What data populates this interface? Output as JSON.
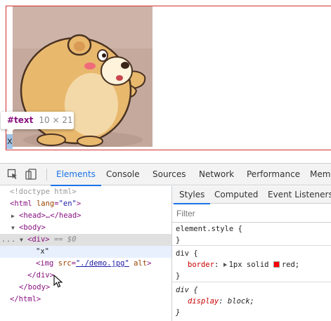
{
  "preview": {
    "text_node": "x",
    "tooltip": {
      "node": "#text",
      "size": "10 × 21"
    }
  },
  "devtools": {
    "tabs": [
      "Elements",
      "Console",
      "Sources",
      "Network",
      "Performance",
      "Memo"
    ],
    "active_tab": "Elements",
    "dom": {
      "doctype": "<!doctype html>",
      "html_open": "<html",
      "html_attr_name": "lang",
      "html_attr_value": "\"en\"",
      "head_collapsed": "<head>…</head>",
      "body_open": "<body>",
      "div_open": "<div>",
      "selected_marker": "== $0",
      "text_node": "\"x\"",
      "img_open": "<img",
      "img_attr_src": "src",
      "img_attr_src_value": "\"./demo.jpg\"",
      "img_attr_alt": "alt",
      "img_close": ">",
      "div_close": "</div>",
      "body_close": "</body>",
      "html_close": "</html>",
      "gutter": "..."
    },
    "styles": {
      "subtabs": [
        "Styles",
        "Computed",
        "Event Listeners"
      ],
      "filter_placeholder": "Filter",
      "rules": [
        {
          "selector": "element.style {",
          "close": "}"
        },
        {
          "selector": "div {",
          "property": "border",
          "value": "1px solid ",
          "value_color": "red",
          "close": "}"
        },
        {
          "selector": "div {",
          "property": "display",
          "value": "block",
          "close": "}"
        }
      ]
    }
  },
  "colors": {
    "accent": "#1a73e8",
    "border_red": "#d32f2f",
    "tag": "#881280",
    "attr_name": "#994500",
    "attr_value": "#1a1aa6"
  }
}
